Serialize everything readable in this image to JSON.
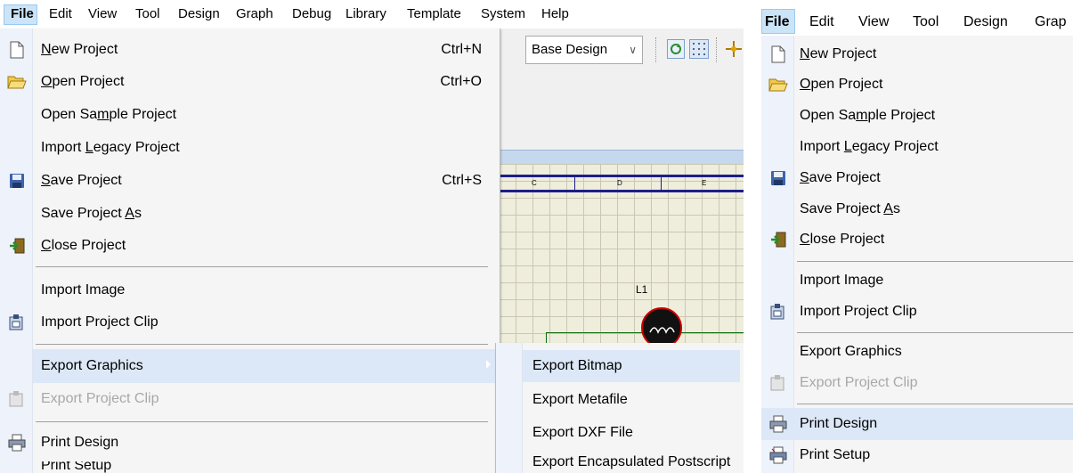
{
  "left": {
    "menubar": [
      "File",
      "Edit",
      "View",
      "Tool",
      "Design",
      "Graph",
      "Debug",
      "Library",
      "Template",
      "System",
      "Help"
    ],
    "toolbar": {
      "design_select": "Base Design"
    },
    "schematic": {
      "columns": [
        "C",
        "D",
        "E"
      ],
      "component_label": "L1"
    },
    "file_menu": {
      "new_project": {
        "pre": "",
        "u": "N",
        "post": "ew Project",
        "shortcut": "Ctrl+N"
      },
      "open_project": {
        "pre": "",
        "u": "O",
        "post": "pen Project",
        "shortcut": "Ctrl+O"
      },
      "open_sample_project": {
        "pre": "Open Sa",
        "u": "m",
        "post": "ple Project"
      },
      "import_legacy_project": {
        "pre": "Import ",
        "u": "L",
        "post": "egacy Project"
      },
      "save_project": {
        "pre": "",
        "u": "S",
        "post": "ave Project",
        "shortcut": "Ctrl+S"
      },
      "save_project_as": {
        "pre": "Save Project ",
        "u": "A",
        "post": "s"
      },
      "close_project": {
        "pre": "",
        "u": "C",
        "post": "lose Project"
      },
      "import_image": "Import Image",
      "import_project_clip": "Import Project Clip",
      "export_graphics": "Export Graphics",
      "export_project_clip": "Export Project Clip",
      "print_design": "Print Design",
      "print_setup_partial": "Print Setup"
    },
    "submenu": [
      "Export Bitmap",
      "Export Metafile",
      "Export DXF File",
      "Export Encapsulated Postscript"
    ]
  },
  "right": {
    "menubar": [
      "File",
      "Edit",
      "View",
      "Tool",
      "Design",
      "Grap"
    ],
    "file_menu": {
      "new_project": {
        "pre": "",
        "u": "N",
        "post": "ew Project"
      },
      "open_project": {
        "pre": "",
        "u": "O",
        "post": "pen Project"
      },
      "open_sample_project": {
        "pre": "Open Sa",
        "u": "m",
        "post": "ple Project"
      },
      "import_legacy_project": {
        "pre": "Import ",
        "u": "L",
        "post": "egacy Project"
      },
      "save_project": {
        "pre": "",
        "u": "S",
        "post": "ave Project"
      },
      "save_project_as": {
        "pre": "Save Project ",
        "u": "A",
        "post": "s"
      },
      "close_project": {
        "pre": "",
        "u": "C",
        "post": "lose Project"
      },
      "import_image": "Import Image",
      "import_project_clip": "Import Project Clip",
      "export_graphics": "Export Graphics",
      "export_project_clip": "Export Project Clip",
      "print_design": "Print Design",
      "print_setup": "Print Setup"
    }
  }
}
